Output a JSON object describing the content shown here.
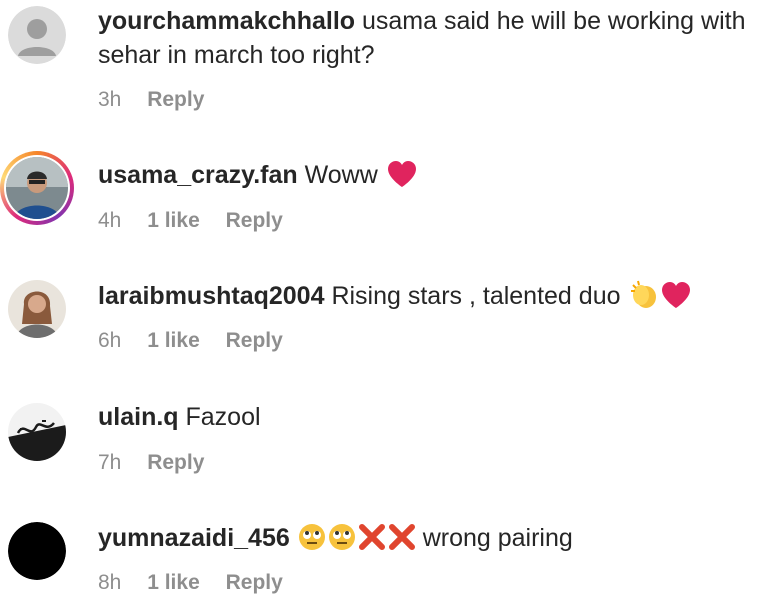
{
  "comments": [
    {
      "username": "yourchammakchhallo",
      "text": " usama said he will be working with sehar in march too right?",
      "time": "3h",
      "likes": "",
      "reply": "Reply",
      "avatar": "default-avatar-icon"
    },
    {
      "username": "usama_crazy.fan",
      "text": " Woww ",
      "time": "4h",
      "likes": "1 like",
      "reply": "Reply",
      "avatar": "profile-photo",
      "emojis": [
        "red-heart"
      ]
    },
    {
      "username": "laraibmushtaq2004",
      "text": " Rising stars , talented duo ",
      "time": "6h",
      "likes": "1 like",
      "reply": "Reply",
      "avatar": "profile-photo",
      "emojis": [
        "clapping-hands",
        "red-heart"
      ]
    },
    {
      "username": "ulain.q",
      "text": " Fazool",
      "time": "7h",
      "likes": "",
      "reply": "Reply",
      "avatar": "calligraphy-photo"
    },
    {
      "username": "yumnazaidi_456",
      "text": " wrong pairing",
      "time": "8h",
      "likes": "1 like",
      "reply": "Reply",
      "avatar": "black-avatar",
      "emojis": [
        "eye-roll-face",
        "eye-roll-face",
        "cross-mark",
        "cross-mark"
      ]
    }
  ],
  "colors": {
    "text": "#262626",
    "meta": "#8e8e8e",
    "heart": "#e0245e"
  }
}
